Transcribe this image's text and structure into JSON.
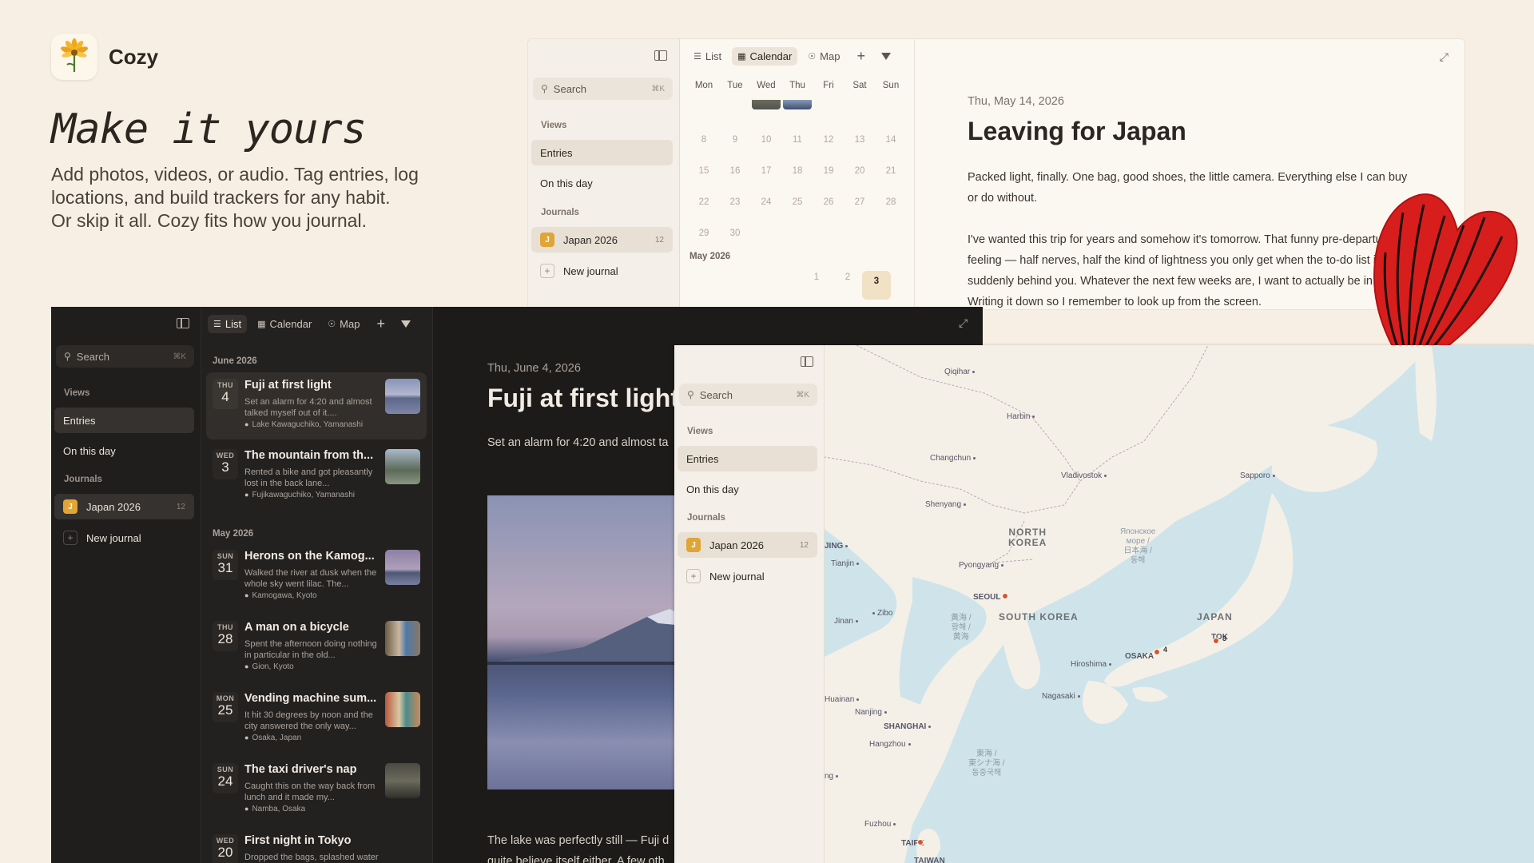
{
  "brand": {
    "name": "Cozy"
  },
  "hero": {
    "headline": "Make it yours",
    "lines": [
      "Add photos, videos, or audio. Tag entries, log",
      "locations, and build trackers for any habit.",
      "Or skip it all. Cozy fits how you journal."
    ]
  },
  "sidebar": {
    "search_placeholder": "Search",
    "search_shortcut": "⌘K",
    "views_label": "Views",
    "entries": "Entries",
    "on_this_day": "On this day",
    "journals_label": "Journals",
    "journal_initial": "J",
    "journal_name": "Japan 2026",
    "journal_count": "12",
    "new_journal": "New journal"
  },
  "toolbar": {
    "list": "List",
    "calendar": "Calendar",
    "map": "Map"
  },
  "calendar": {
    "weekdays": [
      "Mon",
      "Tue",
      "Wed",
      "Thu",
      "Fri",
      "Sat",
      "Sun"
    ],
    "rows": [
      [
        "8",
        "9",
        "10",
        "11",
        "12",
        "13",
        "14"
      ],
      [
        "15",
        "16",
        "17",
        "18",
        "19",
        "20",
        "21"
      ],
      [
        "22",
        "23",
        "24",
        "25",
        "26",
        "27",
        "28"
      ],
      [
        "29",
        "30"
      ]
    ],
    "month2": "May 2026",
    "row2": [
      "1",
      "2",
      "3"
    ]
  },
  "light_entry": {
    "date": "Thu, May 14, 2026",
    "title": "Leaving for Japan",
    "para1": "Packed light, finally. One bag, good shoes, the little camera. Everything else I can buy or do without.",
    "para2": "I've wanted this trip for years and somehow it's tomorrow. That funny pre-departure feeling — half nerves, half the kind of lightness you only get when the to-do list is suddenly behind you. Whatever the next few weeks are, I want to actually be in them. Writing it down so I remember to look up from the screen."
  },
  "dark_list": {
    "group1": "June 2026",
    "group2": "May 2026",
    "entries": [
      {
        "dow": "THU",
        "day": "4",
        "title": "Fuji at first light",
        "snippet": "Set an alarm for 4:20 and almost talked myself out of it....",
        "loc": "Lake Kawaguchiko, Yamanashi"
      },
      {
        "dow": "WED",
        "day": "3",
        "title": "The mountain from th...",
        "snippet": "Rented a bike and got pleasantly lost in the back lane...",
        "loc": "Fujikawaguchiko, Yamanashi"
      },
      {
        "dow": "SUN",
        "day": "31",
        "title": "Herons on the Kamog...",
        "snippet": "Walked the river at dusk when the whole sky went lilac. The...",
        "loc": "Kamogawa, Kyoto"
      },
      {
        "dow": "THU",
        "day": "28",
        "title": "A man on a bicycle",
        "snippet": "Spent the afternoon doing nothing in particular in the old...",
        "loc": "Gion, Kyoto"
      },
      {
        "dow": "MON",
        "day": "25",
        "title": "Vending machine sum...",
        "snippet": "It hit 30 degrees by noon and the city answered the only way...",
        "loc": "Osaka, Japan"
      },
      {
        "dow": "SUN",
        "day": "24",
        "title": "The taxi driver's nap",
        "snippet": "Caught this on the way back from lunch and it made my...",
        "loc": "Namba, Osaka"
      },
      {
        "dow": "WED",
        "day": "20",
        "title": "First night in Tokyo",
        "snippet": "Dropped the bags, splashed water on my",
        "loc": ""
      }
    ]
  },
  "dark_entry": {
    "date": "Thu, June 4, 2026",
    "title": "Fuji at first light",
    "para1": "Set an alarm for 4:20 and almost ta",
    "bottom1": "The lake was perfectly still — Fuji d",
    "bottom2": "quite believe itself either. A few oth"
  },
  "map": {
    "cities": [
      "Qiqihar",
      "Harbin",
      "Changchun",
      "Vladivostok",
      "Sapporo",
      "Shenyang",
      "Pyongyang",
      "SEOUL",
      "Jinan",
      "Zibo",
      "Tianjin",
      "JING",
      "Hiroshima",
      "OSAKA",
      "TOK",
      "Nagasaki",
      "Huainan",
      "Nanjing",
      "SHANGHAI",
      "Hangzhou",
      "ng",
      "Fuzhou",
      "TAIPE",
      "TAIWAN"
    ],
    "countries": [
      "NORTH\nKOREA",
      "SOUTH KOREA",
      "JAPAN"
    ],
    "sea_japan": "Японское\nморе /\n日本海 /\n동해",
    "sea_yellow": "黃海 /\n황해 /\n黄海",
    "sea_east": "東海 /\n東シナ海 /\n동중국해",
    "pin_counts": [
      "4",
      "3"
    ]
  }
}
